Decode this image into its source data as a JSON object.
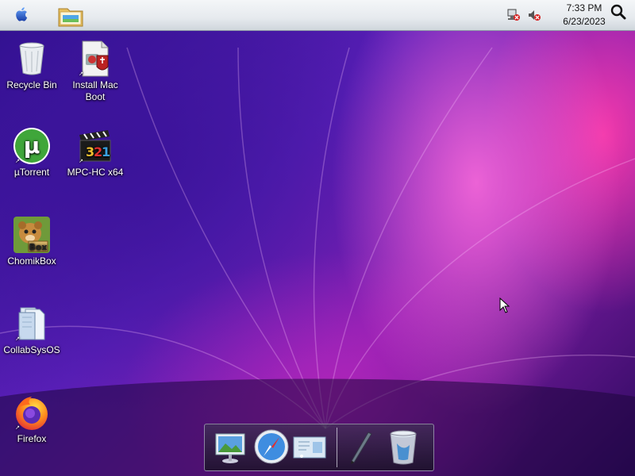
{
  "menubar": {
    "apple_icon": "apple-icon",
    "folder_icon": "folder-icon",
    "tray": {
      "network_icon": "network-disconnected-icon",
      "volume_icon": "volume-muted-icon"
    },
    "clock": {
      "time": "7:33 PM",
      "date": "6/23/2023"
    },
    "search_icon": "search-icon"
  },
  "desktop": {
    "icons": [
      {
        "label": "Recycle Bin",
        "icon": "recycle-bin-icon"
      },
      {
        "label": "Install Mac Boot",
        "icon": "installer-icon"
      },
      {
        "label": "µTorrent",
        "icon": "utorrent-icon"
      },
      {
        "label": "MPC-HC x64",
        "icon": "mpc-hc-icon"
      },
      {
        "label": "ChomikBox",
        "icon": "chomikbox-icon"
      },
      {
        "label": "CollabSysOS",
        "icon": "folder-icon"
      },
      {
        "label": "Firefox",
        "icon": "firefox-icon"
      }
    ]
  },
  "dock": {
    "items": [
      {
        "icon": "preview-icon"
      },
      {
        "icon": "safari-icon"
      },
      {
        "icon": "mail-icon"
      },
      {
        "icon": "pen-icon"
      },
      {
        "icon": "trash-icon"
      }
    ]
  },
  "colors": {
    "menubar": "#e6eaee",
    "wallpaper_primary": "#5a1fb8",
    "wallpaper_accent": "#ff6edc"
  }
}
